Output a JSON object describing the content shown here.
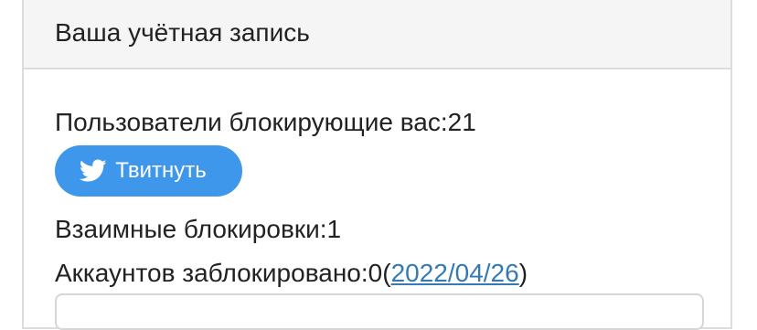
{
  "account_panel": {
    "title": "Ваша учётная запись"
  },
  "stats": {
    "blockers_label": "Пользователи блокирующие вас:",
    "blockers_count": "21",
    "mutual_label": "Взаимные блокировки:",
    "mutual_count": "1",
    "blocked_label": "Аккаунтов заблокировано:",
    "blocked_count": "0",
    "blocked_date": "2022/04/26",
    "paren_open": "(",
    "paren_close": ")"
  },
  "tweet_button": {
    "label": "Твитнуть",
    "icon": "twitter-bird-icon",
    "color": "#3f97ec"
  },
  "colors": {
    "header_bg": "#f5f5f5",
    "border": "#dcdcdc",
    "link": "#337ab7"
  }
}
